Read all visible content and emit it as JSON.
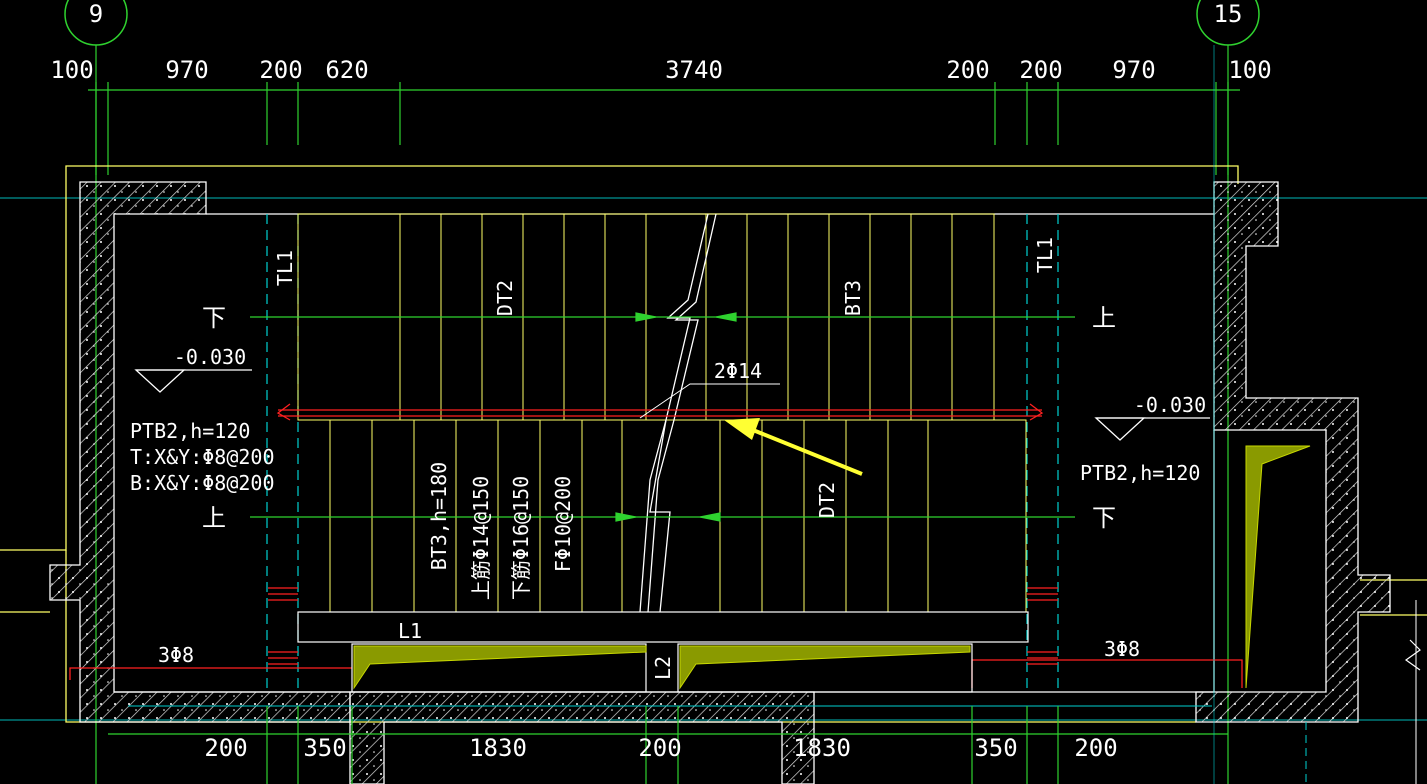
{
  "axes": {
    "left": "9",
    "right": "15"
  },
  "top_dims": [
    "100",
    "970",
    "200",
    "620",
    "3740",
    "200",
    "200",
    "970",
    "100"
  ],
  "bottom_dims": [
    "200",
    "350",
    "1830",
    "200",
    "1830",
    "350",
    "200"
  ],
  "labels": {
    "tl1": "TL1",
    "dt2_upper": "DT2",
    "bt3_upper": "BT3",
    "down": "下",
    "up": "上",
    "level_left": "-0.030",
    "level_right": "-0.030",
    "rebar_2phi14": "2Φ14",
    "ptb2_left": "PTB2,h=120",
    "ptb2_top": "T:X&Y:Φ8@200",
    "ptb2_bottom": "B:X&Y:Φ8@200",
    "ptb2_right": "PTB2,h=120",
    "bt3_h": "BT3,h=180",
    "bt3_top": "上筋Φ14@150",
    "bt3_bot": "下筋Φ16@150",
    "bt3_f": "FΦ10@200",
    "dt2_lower": "DT2",
    "l1": "L1",
    "l2": "L2",
    "rebar_3phi8_left": "3Φ8",
    "rebar_3phi8_right": "3Φ8"
  },
  "colors": {
    "background": "#000000",
    "dim_line": "#00ff00",
    "outline": "#ffff66",
    "axis": "#00ffff",
    "rebar": "#ff2020",
    "arrow": "#ffff33",
    "fill": "#8a9a00"
  }
}
